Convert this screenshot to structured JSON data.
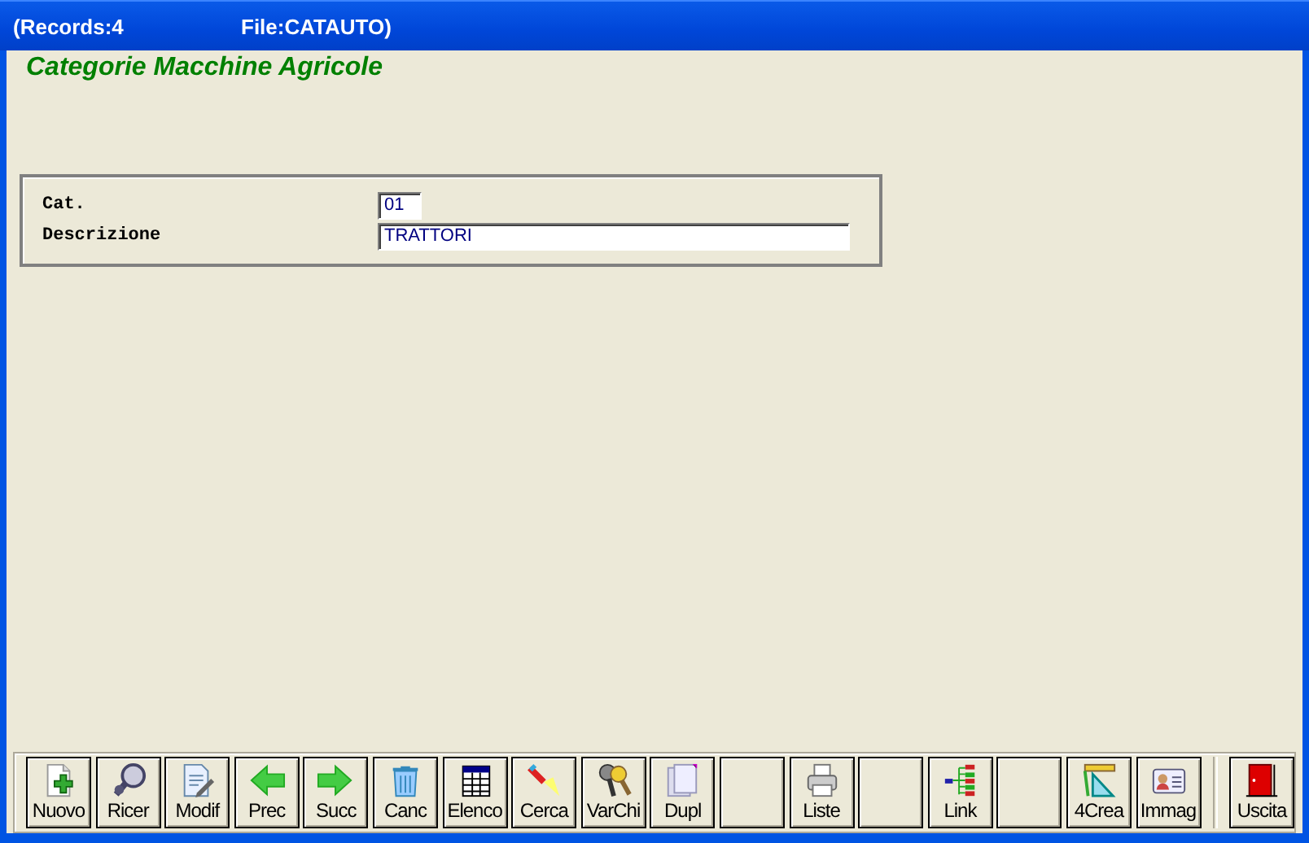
{
  "window": {
    "title": {
      "records": "(Records:4",
      "file": "File:CATAUTO)"
    }
  },
  "heading": "Categorie Macchine Agricole",
  "form": {
    "fields": [
      {
        "label": "Cat.",
        "value": "01",
        "kind": "short"
      },
      {
        "label": "Descrizione",
        "value": "TRATTORI",
        "kind": "long"
      }
    ]
  },
  "toolbar": {
    "buttons": [
      {
        "kind": "command",
        "label": "Nuovo"
      },
      {
        "kind": "command",
        "label": "Ricer"
      },
      {
        "kind": "command",
        "label": "Modif"
      },
      {
        "kind": "command",
        "label": "Prec"
      },
      {
        "kind": "command",
        "label": "Succ"
      },
      {
        "kind": "command",
        "label": "Canc"
      },
      {
        "kind": "command",
        "label": "Elenco"
      },
      {
        "kind": "command",
        "label": "Cerca"
      },
      {
        "kind": "command",
        "label": "VarChi"
      },
      {
        "kind": "command",
        "label": "Dupl"
      },
      {
        "kind": "blank"
      },
      {
        "kind": "command",
        "label": "Liste"
      },
      {
        "kind": "blank"
      },
      {
        "kind": "command",
        "label": "Link"
      },
      {
        "kind": "blank"
      },
      {
        "kind": "command",
        "label": "4Crea"
      },
      {
        "kind": "command",
        "label": "Immag"
      }
    ],
    "exit_button": {
      "label": "Uscita"
    }
  }
}
